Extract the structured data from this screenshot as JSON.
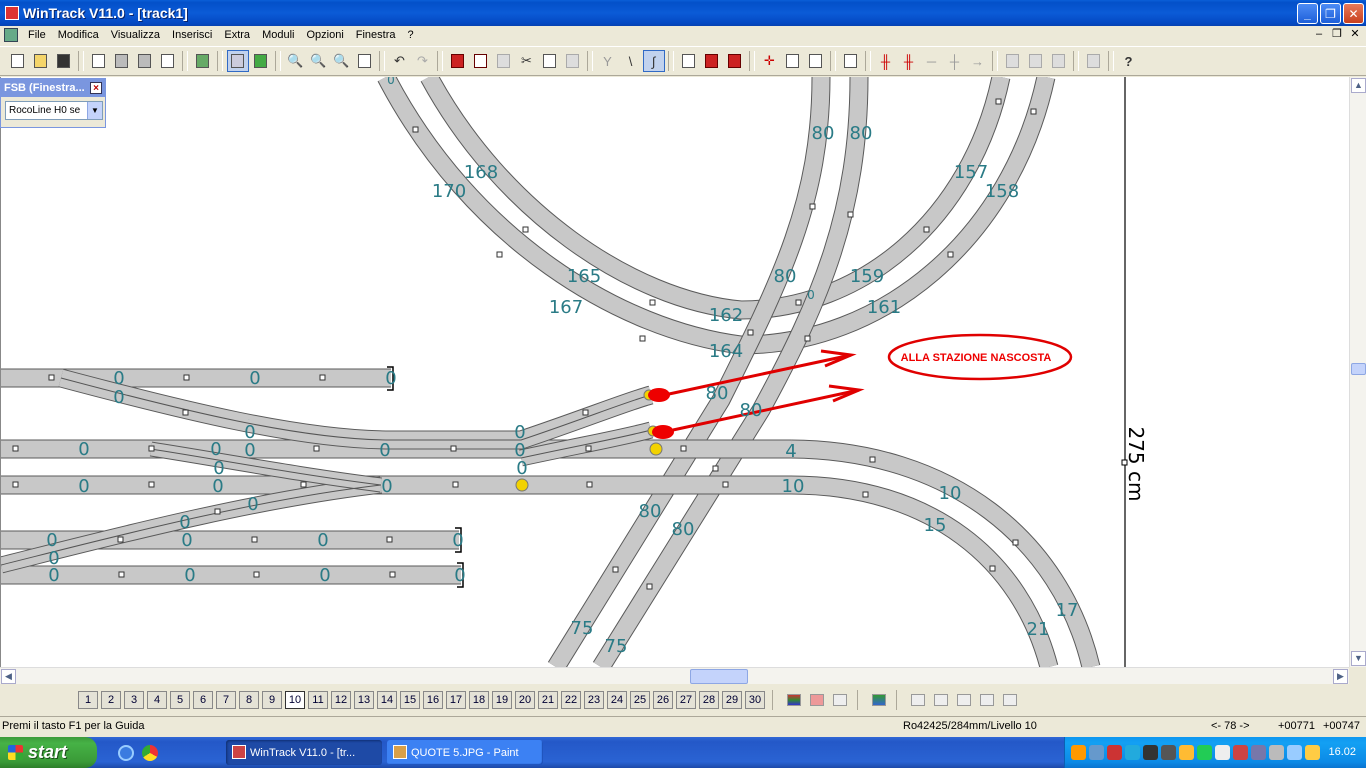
{
  "window": {
    "title": "WinTrack  V11.0 - [track1]",
    "buttons": {
      "minimize": "_",
      "restore": "❐",
      "close": "✕"
    }
  },
  "menu": {
    "items": [
      "File",
      "Modifica",
      "Visualizza",
      "Inserisci",
      "Extra",
      "Moduli",
      "Opzioni",
      "Finestra",
      "?"
    ],
    "mdi": {
      "minimize": "–",
      "restore": "❐",
      "close": "✕"
    }
  },
  "fsb": {
    "title": "FSB (Finestra...",
    "selected": "RocoLine H0 se"
  },
  "canvas": {
    "dimension_label": "275 cm",
    "annotation": "ALLA STAZIONE NASCOSTA",
    "track_labels": {
      "l80a": "80",
      "l80b": "80",
      "l168": "168",
      "l170": "170",
      "l157": "157",
      "l158": "158",
      "l165": "165",
      "l167": "167",
      "l80c": "80",
      "l159": "159",
      "l162": "162",
      "l161": "161",
      "l164": "164",
      "l80d": "80",
      "l80e": "80",
      "l4": "4",
      "l10a": "10",
      "l10b": "10",
      "l15": "15",
      "l80f": "80",
      "l80g": "80",
      "l17": "17",
      "l21": "21",
      "l75a": "75",
      "l75b": "75",
      "z1": "0",
      "z2": "0",
      "z3": "0",
      "z4": "0",
      "z5": "0",
      "z6": "0",
      "z7": "0",
      "z8": "0",
      "z9": "0",
      "z10": "0",
      "z11": "0",
      "z12": "0",
      "z13": "0",
      "z14": "0",
      "z15": "0",
      "z16": "0",
      "z17": "0",
      "z18": "0",
      "z19": "0",
      "z20": "0",
      "z21": "0",
      "z22": "0",
      "z23": "0",
      "z24": "0",
      "z25": "0",
      "z26": "0",
      "z27": "0",
      "z28": "0",
      "z29": "0",
      "z30": "0"
    }
  },
  "levels": {
    "buttons": [
      "1",
      "2",
      "3",
      "4",
      "5",
      "6",
      "7",
      "8",
      "9",
      "10",
      "11",
      "12",
      "13",
      "14",
      "15",
      "16",
      "17",
      "18",
      "19",
      "20",
      "21",
      "22",
      "23",
      "24",
      "25",
      "26",
      "27",
      "28",
      "29",
      "30"
    ]
  },
  "status": {
    "help": "Premi il tasto F1 per la Guida",
    "info": "Ro42425/284mm/Livello 10",
    "nav": "<- 78 ->",
    "x": "+00771",
    "y": "+00747"
  },
  "taskbar": {
    "start": "start",
    "tasks": [
      "WinTrack  V11.0 - [tr...",
      "QUOTE 5.JPG - Paint"
    ],
    "clock": "16.02"
  },
  "colors": {
    "track": "#c8c8c8",
    "label": "#2a7b86",
    "annotation": "#e00000",
    "signal_red": "#ee0000",
    "signal_yellow": "#f2d200"
  }
}
